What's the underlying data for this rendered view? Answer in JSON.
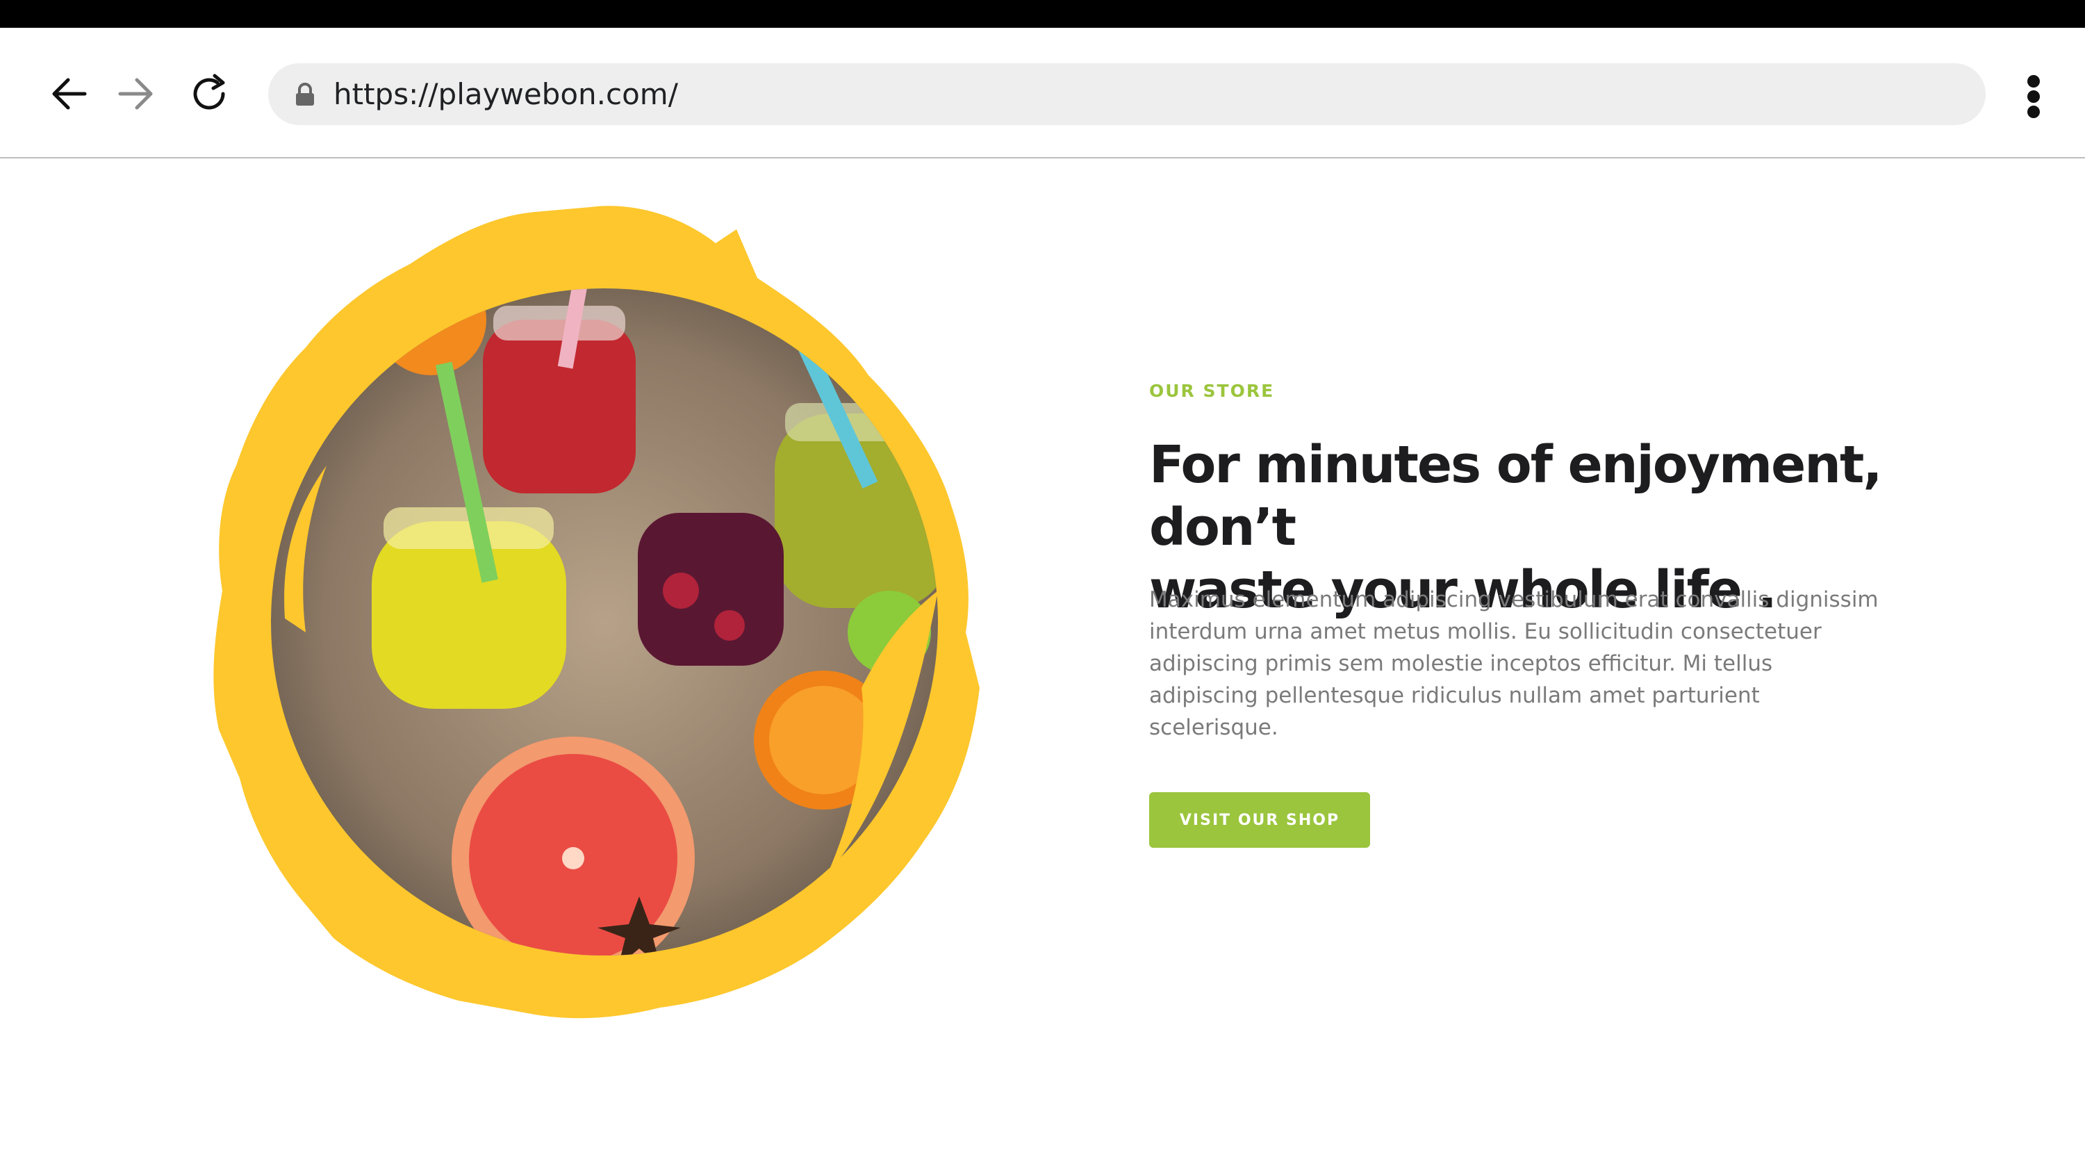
{
  "browser": {
    "url": "https://playwebon.com/",
    "icons": {
      "back": "arrow-left-icon",
      "forward": "arrow-right-icon",
      "reload": "reload-icon",
      "lock": "lock-icon",
      "menu": "kebab-menu-icon"
    }
  },
  "section": {
    "eyebrow": "OUR STORE",
    "heading_line1": "For minutes of enjoyment, don’t",
    "heading_line2": "waste your whole life .",
    "body_lines": [
      "Maximus elementum adipiscing vestibulum erat convallis dignissim",
      "interdum urna amet metus mollis. Eu sollicitudin consectetuer",
      "adipiscing primis sem molestie inceptos efficitur. Mi tellus",
      "adipiscing pellentesque ridiculus nullam amet parturient",
      "scelerisque."
    ],
    "button_label": "VISIT OUR SHOP"
  },
  "colors": {
    "accent_green": "#9bc53d",
    "brush_yellow": "#fdc72d",
    "heading": "#1d1d1f",
    "body": "#7a7a7a"
  }
}
